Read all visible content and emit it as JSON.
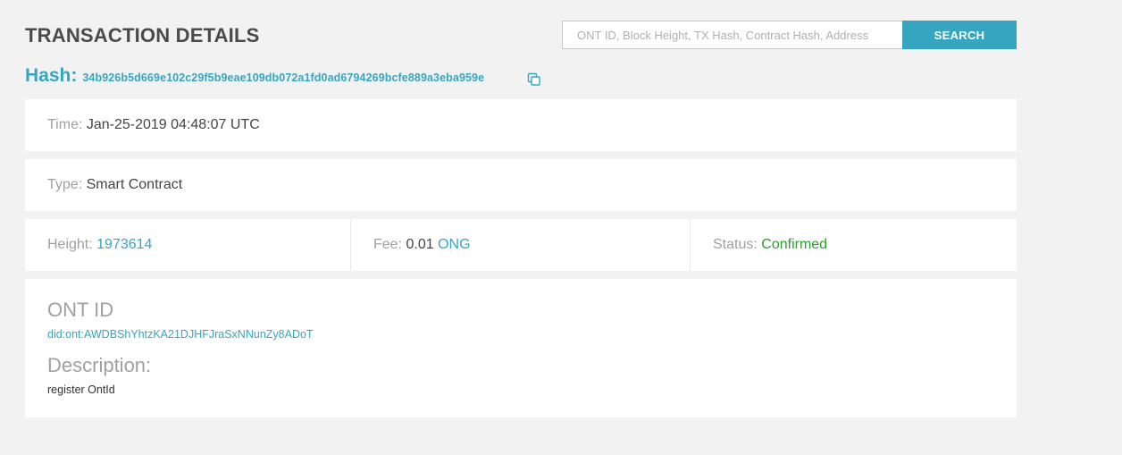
{
  "header": {
    "title": "TRANSACTION DETAILS"
  },
  "search": {
    "placeholder": "ONT ID, Block Height, TX Hash, Contract Hash, Address",
    "button_label": "SEARCH"
  },
  "hash": {
    "label": "Hash:",
    "value": "34b926b5d669e102c29f5b9eae109db072a1fd0ad6794269bcfe889a3eba959e"
  },
  "time": {
    "label": "Time:",
    "value": "Jan-25-2019 04:48:07 UTC"
  },
  "type": {
    "label": "Type:",
    "value": "Smart Contract"
  },
  "height": {
    "label": "Height:",
    "value": "1973614"
  },
  "fee": {
    "label": "Fee:",
    "amount": "0.01",
    "unit": "ONG"
  },
  "status": {
    "label": "Status:",
    "value": "Confirmed"
  },
  "ont_id": {
    "heading": "ONT ID",
    "value": "did:ont:AWDBShYhtzKA21DJHFJraSxNNunZy8ADoT"
  },
  "description": {
    "heading": "Description:",
    "value": "register OntId"
  },
  "colors": {
    "accent": "#36a6c0",
    "status_ok": "#2ca02c",
    "label_gray": "#a0a0a0",
    "background": "#f2f2f2"
  },
  "icons": {
    "copy": "copy-icon"
  }
}
